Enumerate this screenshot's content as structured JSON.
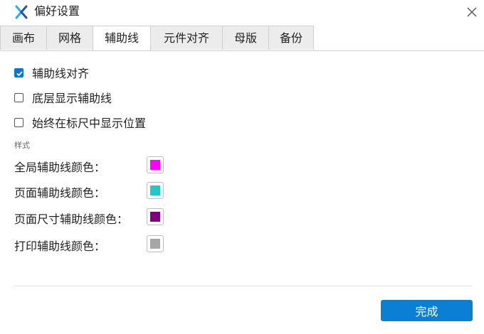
{
  "window": {
    "title": "偏好设置",
    "logo_icon": "x-logo-icon",
    "close_icon": "close-icon"
  },
  "tabs": [
    {
      "label": "画布",
      "active": false
    },
    {
      "label": "网格",
      "active": false
    },
    {
      "label": "辅助线",
      "active": true
    },
    {
      "label": "元件对齐",
      "active": false
    },
    {
      "label": "母版",
      "active": false
    },
    {
      "label": "备份",
      "active": false
    }
  ],
  "options": [
    {
      "label": "辅助线对齐",
      "checked": true
    },
    {
      "label": "底层显示辅助线",
      "checked": false
    },
    {
      "label": "始终在标尺中显示位置",
      "checked": false
    }
  ],
  "style_section": {
    "label": "样式",
    "colors": [
      {
        "label": "全局辅助线颜色：",
        "color": "#ff00ff"
      },
      {
        "label": "页面辅助线颜色：",
        "color": "#22c8c8"
      },
      {
        "label": "页面尺寸辅助线颜色：",
        "color": "#800080"
      },
      {
        "label": "打印辅助线颜色：",
        "color": "#a6a6a6"
      }
    ]
  },
  "footer": {
    "done_label": "完成",
    "accent": "#0a7fd4"
  }
}
